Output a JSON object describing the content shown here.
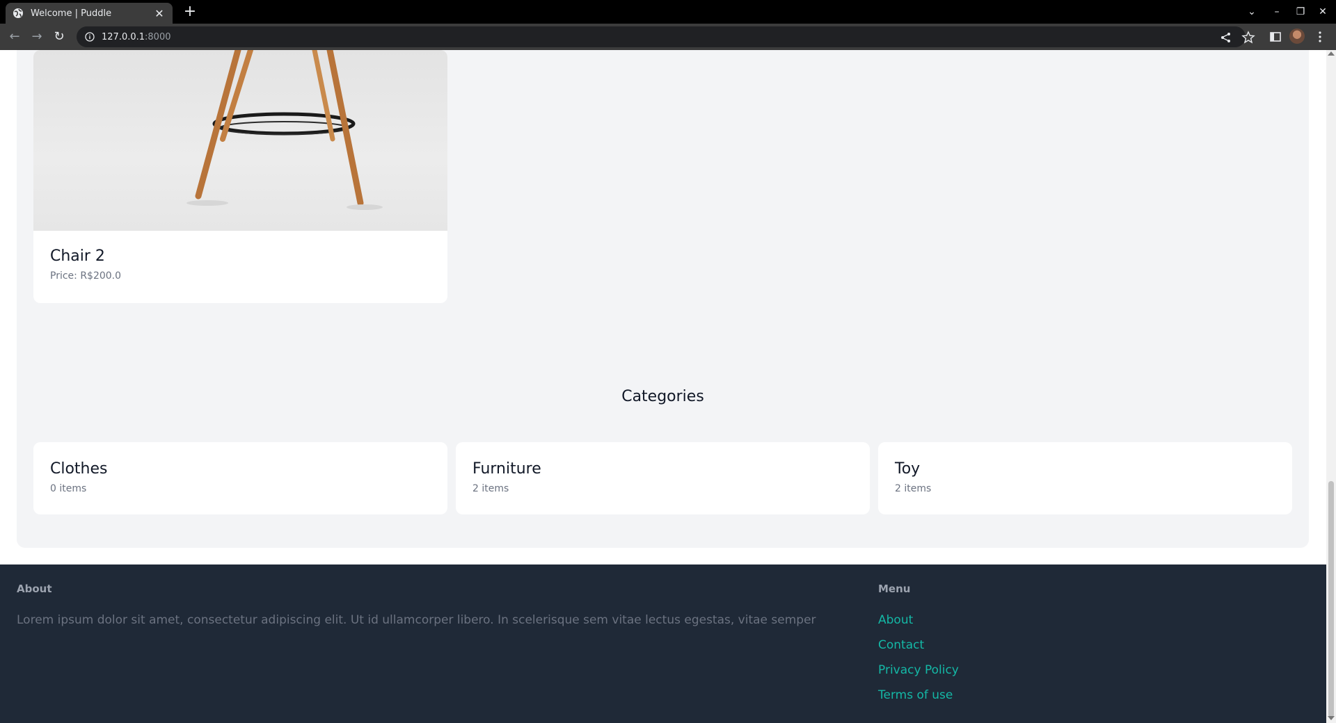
{
  "browser": {
    "tab_title": "Welcome | Puddle",
    "url_host": "127.0.0.1",
    "url_port": ":8000"
  },
  "items": [
    {
      "name": "Chair 2",
      "price": "Price: R$200.0"
    }
  ],
  "categories_section": {
    "title": "Categories",
    "categories": [
      {
        "name": "Clothes",
        "count": "0 items"
      },
      {
        "name": "Furniture",
        "count": "2 items"
      },
      {
        "name": "Toy",
        "count": "2 items"
      }
    ]
  },
  "footer": {
    "about_heading": "About",
    "about_text": "Lorem ipsum dolor sit amet, consectetur adipiscing elit. Ut id ullamcorper libero. In scelerisque sem vitae lectus egestas, vitae semper",
    "menu_heading": "Menu",
    "menu_links": [
      "About",
      "Contact",
      "Privacy Policy",
      "Terms of use"
    ]
  },
  "colors": {
    "page_bg": "#f3f4f6",
    "footer_bg": "#1f2937",
    "link": "#14b8a6",
    "text_dark": "#111827",
    "text_muted": "#6b7280"
  }
}
